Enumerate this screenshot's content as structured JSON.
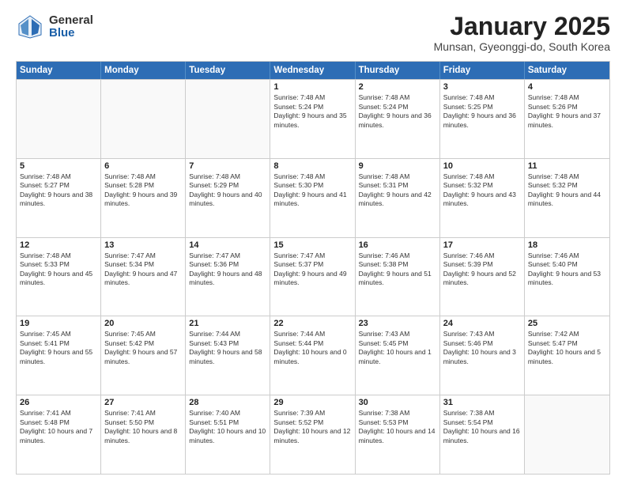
{
  "logo": {
    "general": "General",
    "blue": "Blue"
  },
  "title": "January 2025",
  "location": "Munsan, Gyeonggi-do, South Korea",
  "days": [
    "Sunday",
    "Monday",
    "Tuesday",
    "Wednesday",
    "Thursday",
    "Friday",
    "Saturday"
  ],
  "weeks": [
    [
      {
        "day": "",
        "content": ""
      },
      {
        "day": "",
        "content": ""
      },
      {
        "day": "",
        "content": ""
      },
      {
        "day": "1",
        "content": "Sunrise: 7:48 AM\nSunset: 5:24 PM\nDaylight: 9 hours and 35 minutes."
      },
      {
        "day": "2",
        "content": "Sunrise: 7:48 AM\nSunset: 5:24 PM\nDaylight: 9 hours and 36 minutes."
      },
      {
        "day": "3",
        "content": "Sunrise: 7:48 AM\nSunset: 5:25 PM\nDaylight: 9 hours and 36 minutes."
      },
      {
        "day": "4",
        "content": "Sunrise: 7:48 AM\nSunset: 5:26 PM\nDaylight: 9 hours and 37 minutes."
      }
    ],
    [
      {
        "day": "5",
        "content": "Sunrise: 7:48 AM\nSunset: 5:27 PM\nDaylight: 9 hours and 38 minutes."
      },
      {
        "day": "6",
        "content": "Sunrise: 7:48 AM\nSunset: 5:28 PM\nDaylight: 9 hours and 39 minutes."
      },
      {
        "day": "7",
        "content": "Sunrise: 7:48 AM\nSunset: 5:29 PM\nDaylight: 9 hours and 40 minutes."
      },
      {
        "day": "8",
        "content": "Sunrise: 7:48 AM\nSunset: 5:30 PM\nDaylight: 9 hours and 41 minutes."
      },
      {
        "day": "9",
        "content": "Sunrise: 7:48 AM\nSunset: 5:31 PM\nDaylight: 9 hours and 42 minutes."
      },
      {
        "day": "10",
        "content": "Sunrise: 7:48 AM\nSunset: 5:32 PM\nDaylight: 9 hours and 43 minutes."
      },
      {
        "day": "11",
        "content": "Sunrise: 7:48 AM\nSunset: 5:32 PM\nDaylight: 9 hours and 44 minutes."
      }
    ],
    [
      {
        "day": "12",
        "content": "Sunrise: 7:48 AM\nSunset: 5:33 PM\nDaylight: 9 hours and 45 minutes."
      },
      {
        "day": "13",
        "content": "Sunrise: 7:47 AM\nSunset: 5:34 PM\nDaylight: 9 hours and 47 minutes."
      },
      {
        "day": "14",
        "content": "Sunrise: 7:47 AM\nSunset: 5:36 PM\nDaylight: 9 hours and 48 minutes."
      },
      {
        "day": "15",
        "content": "Sunrise: 7:47 AM\nSunset: 5:37 PM\nDaylight: 9 hours and 49 minutes."
      },
      {
        "day": "16",
        "content": "Sunrise: 7:46 AM\nSunset: 5:38 PM\nDaylight: 9 hours and 51 minutes."
      },
      {
        "day": "17",
        "content": "Sunrise: 7:46 AM\nSunset: 5:39 PM\nDaylight: 9 hours and 52 minutes."
      },
      {
        "day": "18",
        "content": "Sunrise: 7:46 AM\nSunset: 5:40 PM\nDaylight: 9 hours and 53 minutes."
      }
    ],
    [
      {
        "day": "19",
        "content": "Sunrise: 7:45 AM\nSunset: 5:41 PM\nDaylight: 9 hours and 55 minutes."
      },
      {
        "day": "20",
        "content": "Sunrise: 7:45 AM\nSunset: 5:42 PM\nDaylight: 9 hours and 57 minutes."
      },
      {
        "day": "21",
        "content": "Sunrise: 7:44 AM\nSunset: 5:43 PM\nDaylight: 9 hours and 58 minutes."
      },
      {
        "day": "22",
        "content": "Sunrise: 7:44 AM\nSunset: 5:44 PM\nDaylight: 10 hours and 0 minutes."
      },
      {
        "day": "23",
        "content": "Sunrise: 7:43 AM\nSunset: 5:45 PM\nDaylight: 10 hours and 1 minute."
      },
      {
        "day": "24",
        "content": "Sunrise: 7:43 AM\nSunset: 5:46 PM\nDaylight: 10 hours and 3 minutes."
      },
      {
        "day": "25",
        "content": "Sunrise: 7:42 AM\nSunset: 5:47 PM\nDaylight: 10 hours and 5 minutes."
      }
    ],
    [
      {
        "day": "26",
        "content": "Sunrise: 7:41 AM\nSunset: 5:48 PM\nDaylight: 10 hours and 7 minutes."
      },
      {
        "day": "27",
        "content": "Sunrise: 7:41 AM\nSunset: 5:50 PM\nDaylight: 10 hours and 8 minutes."
      },
      {
        "day": "28",
        "content": "Sunrise: 7:40 AM\nSunset: 5:51 PM\nDaylight: 10 hours and 10 minutes."
      },
      {
        "day": "29",
        "content": "Sunrise: 7:39 AM\nSunset: 5:52 PM\nDaylight: 10 hours and 12 minutes."
      },
      {
        "day": "30",
        "content": "Sunrise: 7:38 AM\nSunset: 5:53 PM\nDaylight: 10 hours and 14 minutes."
      },
      {
        "day": "31",
        "content": "Sunrise: 7:38 AM\nSunset: 5:54 PM\nDaylight: 10 hours and 16 minutes."
      },
      {
        "day": "",
        "content": ""
      }
    ]
  ]
}
